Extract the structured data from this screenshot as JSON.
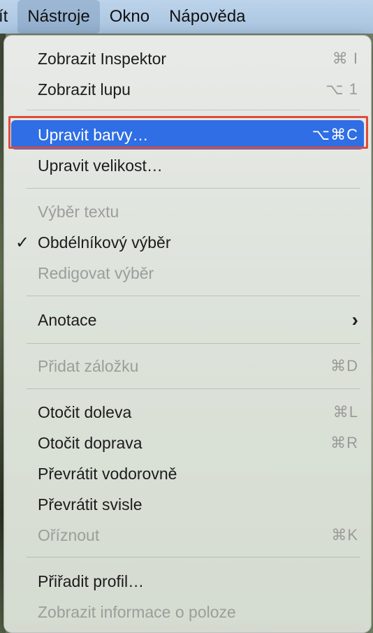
{
  "menubar": {
    "items": [
      {
        "label": "ít",
        "partial": true
      },
      {
        "label": "Nástroje",
        "active": true
      },
      {
        "label": "Okno"
      },
      {
        "label": "Nápověda"
      }
    ]
  },
  "menu": {
    "items": [
      {
        "label": "Zobrazit Inspektor",
        "shortcut": "⌘ I",
        "disabled": false
      },
      {
        "label": "Zobrazit lupu",
        "shortcut": "⌥ 1",
        "disabled": false
      },
      {
        "label": "Upravit barvy…",
        "shortcut": "⌥⌘C",
        "disabled": false,
        "highlighted": true
      },
      {
        "label": "Upravit velikost…",
        "shortcut": "",
        "disabled": false
      },
      {
        "label": "Výběr textu",
        "shortcut": "",
        "disabled": true
      },
      {
        "label": "Obdélníkový výběr",
        "shortcut": "",
        "disabled": false,
        "checked": true
      },
      {
        "label": "Redigovat výběr",
        "shortcut": "",
        "disabled": true
      },
      {
        "label": "Anotace",
        "shortcut": "",
        "disabled": false,
        "submenu": true
      },
      {
        "label": "Přidat záložku",
        "shortcut": "⌘D",
        "disabled": true
      },
      {
        "label": "Otočit doleva",
        "shortcut": "⌘L",
        "disabled": false
      },
      {
        "label": "Otočit doprava",
        "shortcut": "⌘R",
        "disabled": false
      },
      {
        "label": "Převrátit vodorovně",
        "shortcut": "",
        "disabled": false
      },
      {
        "label": "Převrátit svisle",
        "shortcut": "",
        "disabled": false
      },
      {
        "label": "Oříznout",
        "shortcut": "⌘K",
        "disabled": true
      },
      {
        "label": "Přiřadit profil…",
        "shortcut": "",
        "disabled": false
      },
      {
        "label": "Zobrazit informace o poloze",
        "shortcut": "",
        "disabled": true
      }
    ],
    "check_glyph": "✓",
    "submenu_glyph": "›"
  },
  "colors": {
    "highlight": "#2f6ee4",
    "annotation_outline": "#e04a3a",
    "disabled_text": "#9b9e9b"
  }
}
